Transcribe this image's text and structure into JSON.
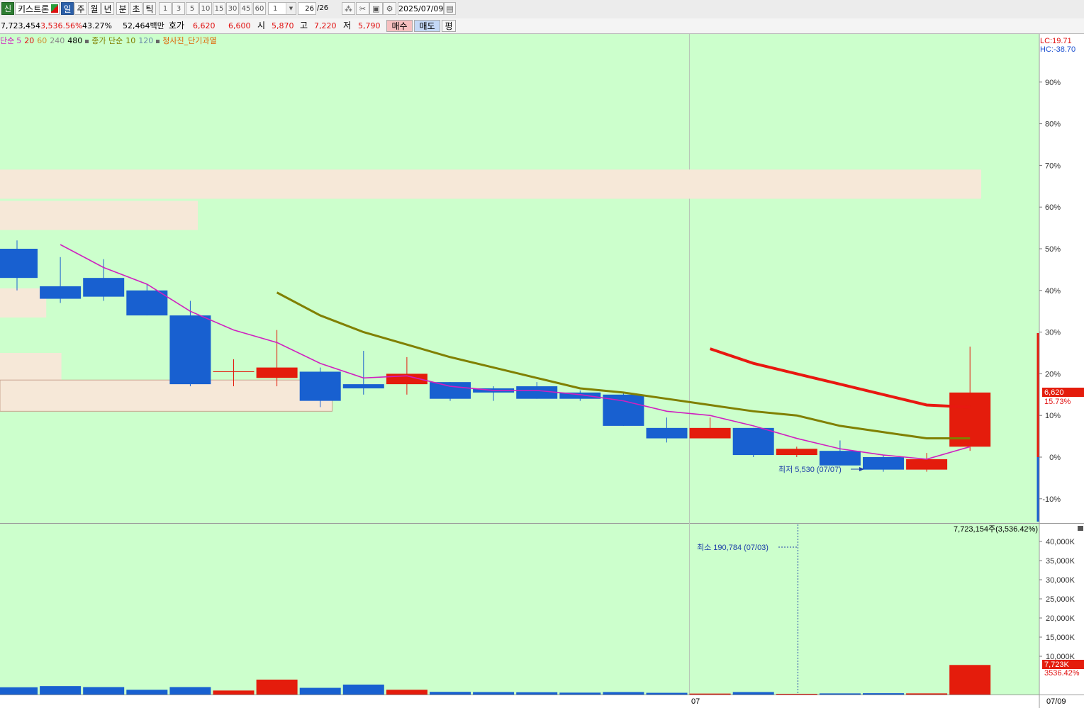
{
  "toolbar": {
    "stock_badge": "신",
    "stock_name": "키스트론",
    "periods": [
      "일",
      "주",
      "월",
      "년",
      "분",
      "초",
      "틱"
    ],
    "active_period": "일",
    "minute_steps": [
      "1",
      "3",
      "5",
      "10",
      "15",
      "30",
      "45",
      "60"
    ],
    "custom_interval": "1",
    "page_count": "26",
    "page_total": "/26",
    "date": "2025/07/09"
  },
  "info": {
    "volume": "7,723,454",
    "volume_change": "3,536.56%",
    "turnover_rate": "43.27%",
    "amount": "52,464백만",
    "quote_label": "호가",
    "ask": "6,620",
    "bid": "6,600",
    "open_label": "시",
    "open": "5,870",
    "high_label": "고",
    "high": "7,220",
    "low_label": "저",
    "low": "5,790",
    "buy_label": "매수",
    "sell_label": "매도",
    "eval_label": "평"
  },
  "legend": {
    "ma_label": "단순",
    "ma_periods": [
      "5",
      "20",
      "60",
      "240",
      "480"
    ],
    "ma_colors": [
      "#d020c0",
      "#e01010",
      "#d09030",
      "#8a8a8a",
      "#000000"
    ],
    "close_ma_label": "종가 단순",
    "close_ma_periods": [
      "10",
      "120"
    ],
    "close_ma_colors": [
      "#808000",
      "#6a8aaa"
    ],
    "signal_label": "청사진_단기과열",
    "signal_color": "#e06000"
  },
  "right_axis": {
    "lc": "LC:19.71",
    "hc": "HC:-38.70",
    "percent_ticks": [
      "90%",
      "80%",
      "70%",
      "60%",
      "50%",
      "40%",
      "30%",
      "20%",
      "10%",
      "0%",
      "-10%"
    ],
    "current_price": "6,620",
    "current_change": "15.73%",
    "volume_ticks": [
      "40,000K",
      "35,000K",
      "30,000K",
      "25,000K",
      "20,000K",
      "15,000K",
      "10,000K"
    ],
    "current_volume": "7,723K",
    "current_volume_pct": "3536.42%"
  },
  "annotations": {
    "lowest_price": "최저 5,530 (07/07)",
    "lowest_volume": "최소 190,784 (07/03)",
    "volume_summary": "7,723,154주(3,536.42%)"
  },
  "x_axis": {
    "month_label": "07",
    "last_date": "07/09"
  },
  "colors": {
    "chart_bg": "#ccffcc",
    "up": "#e41c0c",
    "down": "#1860d0",
    "zone": "#f6e8d8",
    "ma5": "#d020c0",
    "ma10": "#808000",
    "ma20": "#e81810"
  },
  "chart_data": {
    "type": "candlestick",
    "price_axis": "percent change",
    "ylim": [
      -15,
      100
    ],
    "candles_pct": [
      {
        "open": 50,
        "close": 43,
        "high": 52,
        "low": 40,
        "dir": "down"
      },
      {
        "open": 41,
        "close": 38,
        "high": 48,
        "low": 37,
        "dir": "down"
      },
      {
        "open": 43,
        "close": 38.5,
        "high": 47.5,
        "low": 37.5,
        "dir": "down"
      },
      {
        "open": 40,
        "close": 34,
        "high": 41.5,
        "low": 34,
        "dir": "down"
      },
      {
        "open": 34,
        "close": 17.5,
        "high": 37.5,
        "low": 17,
        "dir": "down"
      },
      {
        "open": 20.5,
        "close": 20.5,
        "high": 23.5,
        "low": 17,
        "dir": "up"
      },
      {
        "open": 19,
        "close": 21.5,
        "high": 30.5,
        "low": 17,
        "dir": "up"
      },
      {
        "open": 20.5,
        "close": 13.5,
        "high": 21.5,
        "low": 12,
        "dir": "down"
      },
      {
        "open": 17.5,
        "close": 16.5,
        "high": 25.5,
        "low": 15,
        "dir": "down"
      },
      {
        "open": 17.5,
        "close": 20,
        "high": 24,
        "low": 15,
        "dir": "up"
      },
      {
        "open": 18,
        "close": 14,
        "high": 18,
        "low": 13.5,
        "dir": "down"
      },
      {
        "open": 16.5,
        "close": 15.5,
        "high": 17,
        "low": 13.5,
        "dir": "down"
      },
      {
        "open": 17,
        "close": 14,
        "high": 18,
        "low": 14,
        "dir": "down"
      },
      {
        "open": 15.5,
        "close": 14,
        "high": 16,
        "low": 13.5,
        "dir": "down"
      },
      {
        "open": 15,
        "close": 7.5,
        "high": 15.5,
        "low": 7.5,
        "dir": "down"
      },
      {
        "open": 7,
        "close": 4.5,
        "high": 9.5,
        "low": 3.5,
        "dir": "down"
      },
      {
        "open": 4.5,
        "close": 7,
        "high": 9.5,
        "low": 4.5,
        "dir": "up"
      },
      {
        "open": 7,
        "close": 0.5,
        "high": 7,
        "low": 0,
        "dir": "down"
      },
      {
        "open": 0.5,
        "close": 2,
        "high": 2.5,
        "low": 0,
        "dir": "up"
      },
      {
        "open": 1.5,
        "close": -2,
        "high": 4,
        "low": -2,
        "dir": "down"
      },
      {
        "open": 0,
        "close": -3,
        "high": 0.5,
        "low": -3.5,
        "dir": "down"
      },
      {
        "open": -3,
        "close": -0.5,
        "high": 1,
        "low": -3.5,
        "dir": "up"
      },
      {
        "open": 2.5,
        "close": 15.5,
        "high": 26.5,
        "low": 1.5,
        "dir": "up"
      }
    ],
    "ma5_pct": [
      null,
      51,
      45.5,
      41.5,
      35,
      30.5,
      27.5,
      22.5,
      19,
      19.5,
      17,
      16,
      16,
      15,
      13.5,
      11,
      10,
      7.5,
      4.5,
      2,
      0.5,
      -0.5,
      2.5
    ],
    "ma10_pct": [
      null,
      null,
      null,
      null,
      null,
      null,
      39.5,
      34,
      30,
      27,
      24,
      21.5,
      19,
      16.5,
      15.5,
      14,
      12.5,
      11,
      10,
      7.5,
      6,
      4.5,
      4.5
    ],
    "ma20_pct": [
      null,
      null,
      null,
      null,
      null,
      null,
      null,
      null,
      null,
      null,
      null,
      null,
      null,
      null,
      null,
      null,
      26,
      22.5,
      20,
      17.5,
      15,
      12.5,
      12
    ],
    "zones_pct": [
      {
        "from": 62,
        "to": 69,
        "start": 0,
        "end": 22.8
      },
      {
        "from": 54.5,
        "to": 61.5,
        "start": 0,
        "end": 3.7
      },
      {
        "from": 33.5,
        "to": 40.5,
        "start": 0,
        "end": 0.2
      },
      {
        "from": 18.5,
        "to": 25,
        "start": 0,
        "end": 0.55
      },
      {
        "from": 11,
        "to": 18.5,
        "start": 0,
        "end": 6.8
      }
    ],
    "volume_k": [
      1900,
      2200,
      1950,
      1250,
      1950,
      1050,
      3900,
      1750,
      2600,
      1250,
      700,
      650,
      600,
      500,
      650,
      450,
      250,
      650,
      191,
      300,
      350,
      300,
      7723
    ],
    "volume_dir": [
      "down",
      "down",
      "down",
      "down",
      "down",
      "up",
      "up",
      "down",
      "down",
      "up",
      "down",
      "down",
      "down",
      "down",
      "down",
      "down",
      "up",
      "down",
      "up",
      "down",
      "down",
      "up",
      "up"
    ],
    "volume_ylim": [
      0,
      42000
    ]
  }
}
